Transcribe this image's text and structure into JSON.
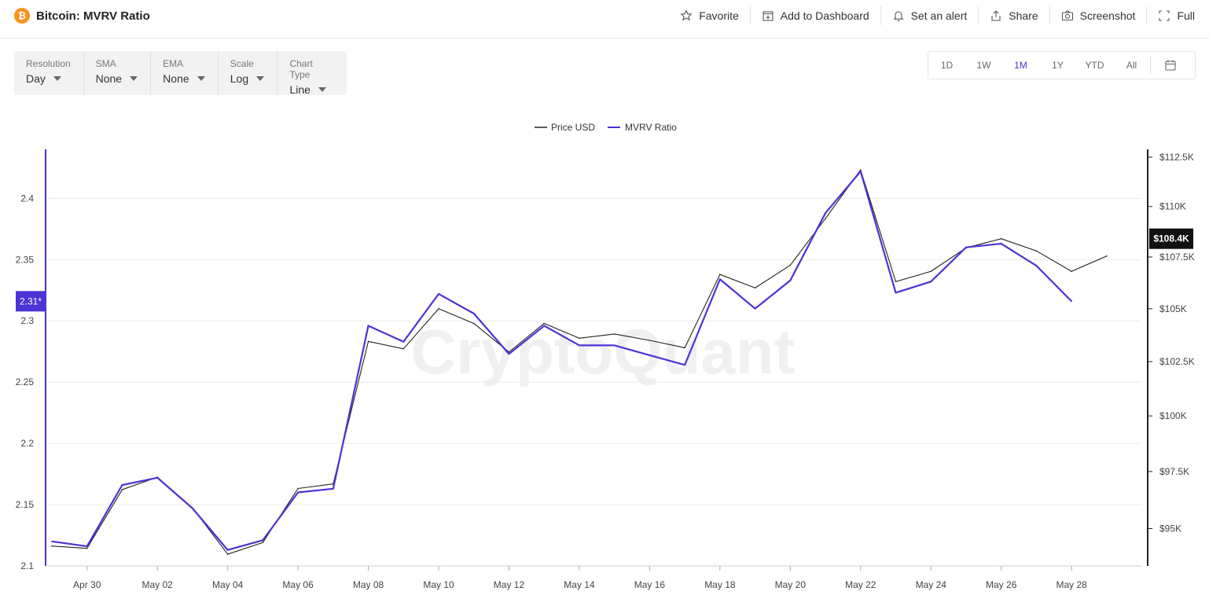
{
  "header": {
    "title": "Bitcoin: MVRV Ratio",
    "coin_symbol": "₿",
    "actions": [
      {
        "label": "Favorite",
        "icon": "star-icon"
      },
      {
        "label": "Add to Dashboard",
        "icon": "dashboard-add-icon"
      },
      {
        "label": "Set an alert",
        "icon": "bell-icon"
      },
      {
        "label": "Share",
        "icon": "share-icon"
      },
      {
        "label": "Screenshot",
        "icon": "camera-icon"
      },
      {
        "label": "Full",
        "icon": "fullscreen-icon"
      }
    ]
  },
  "controls": [
    {
      "label": "Resolution",
      "value": "Day"
    },
    {
      "label": "SMA",
      "value": "None"
    },
    {
      "label": "EMA",
      "value": "None"
    },
    {
      "label": "Scale",
      "value": "Log"
    },
    {
      "label": "Chart Type",
      "value": "Line"
    }
  ],
  "ranges": {
    "options": [
      "1D",
      "1W",
      "1M",
      "1Y",
      "YTD",
      "All"
    ],
    "active": "1M",
    "calendar_icon": "calendar-icon"
  },
  "colors": {
    "mvrv": "#4b33d6",
    "price": "#222222",
    "bitcoin": "#f7931a",
    "grid": "#ececec",
    "watermark": "#f0f0f0"
  },
  "watermark": "CryptoQuant",
  "chart_data": {
    "type": "line",
    "x": [
      "Apr 29",
      "Apr 30",
      "May 01",
      "May 02",
      "May 03",
      "May 04",
      "May 05",
      "May 06",
      "May 07",
      "May 08",
      "May 09",
      "May 10",
      "May 11",
      "May 12",
      "May 13",
      "May 14",
      "May 15",
      "May 16",
      "May 17",
      "May 18",
      "May 19",
      "May 20",
      "May 21",
      "May 22",
      "May 23",
      "May 24",
      "May 25",
      "May 26",
      "May 27",
      "May 28",
      "May 29"
    ],
    "x_ticks": [
      "Apr 30",
      "May 02",
      "May 04",
      "May 06",
      "May 08",
      "May 10",
      "May 12",
      "May 14",
      "May 16",
      "May 18",
      "May 20",
      "May 22",
      "May 24",
      "May 26",
      "May 28"
    ],
    "series": [
      {
        "name": "Price USD",
        "axis": "right",
        "values": [
          94250,
          94150,
          96700,
          97250,
          95900,
          93900,
          94400,
          96750,
          96950,
          103450,
          103100,
          105000,
          104300,
          102950,
          104300,
          103600,
          103800,
          103500,
          103150,
          106650,
          106000,
          107100,
          109400,
          111850,
          106300,
          106800,
          107950,
          108400,
          107800,
          106800,
          107550
        ]
      },
      {
        "name": "MVRV Ratio",
        "axis": "left",
        "values": [
          2.12,
          2.116,
          2.166,
          2.172,
          2.147,
          2.113,
          2.121,
          2.16,
          2.163,
          2.296,
          2.283,
          2.322,
          2.306,
          2.273,
          2.296,
          2.28,
          2.28,
          2.272,
          2.264,
          2.334,
          2.31,
          2.333,
          2.388,
          2.422,
          2.323,
          2.332,
          2.36,
          2.363,
          2.345,
          2.316,
          null
        ]
      }
    ],
    "y_left": {
      "ticks": [
        "2.1",
        "2.15",
        "2.2",
        "2.25",
        "2.3",
        "2.35",
        "2.4"
      ],
      "range": [
        2.1,
        2.44
      ]
    },
    "y_right": {
      "ticks": [
        "$95K",
        "$97.5K",
        "$100K",
        "$102.5K",
        "$105K",
        "$107.5K",
        "$110K",
        "$112.5K"
      ],
      "scale": "log",
      "range": [
        93400,
        112900
      ]
    },
    "current_labels": {
      "left": "2.31*",
      "right": "$108.4K"
    },
    "grid": true,
    "legend_position": "top-center"
  }
}
